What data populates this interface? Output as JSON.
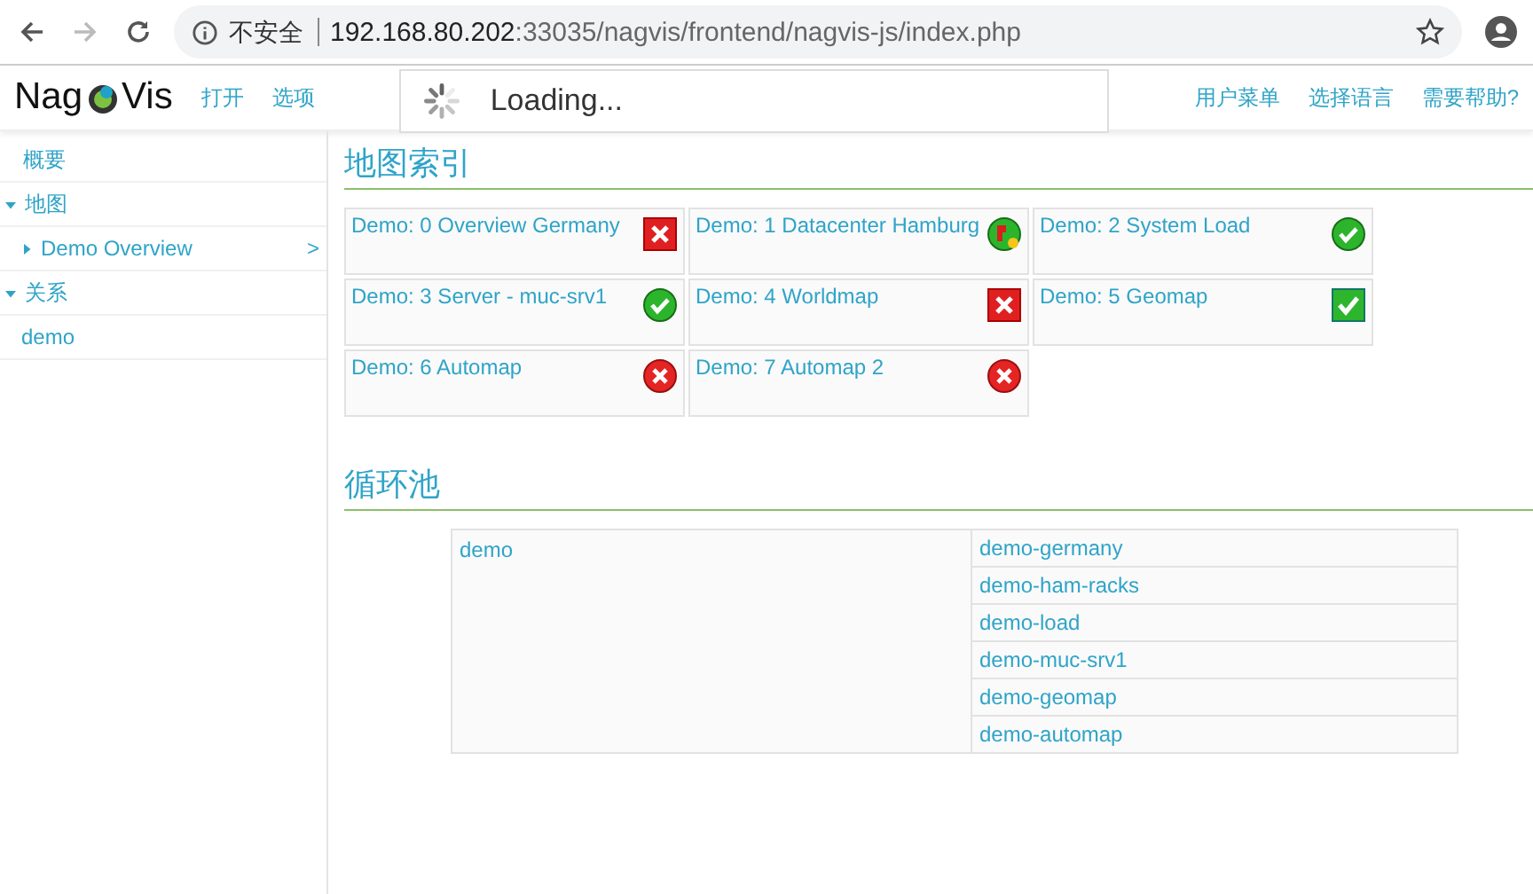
{
  "browser": {
    "security": "不安全",
    "url_host": "192.168.80.202",
    "url_rest": ":33035/nagvis/frontend/nagvis-js/index.php"
  },
  "header": {
    "logo_left": "Nag",
    "logo_right": "Vis",
    "menu": [
      "打开",
      "选项"
    ],
    "right_menu": [
      "用户菜单",
      "选择语言",
      "需要帮助?"
    ]
  },
  "loading": {
    "text": "Loading..."
  },
  "sidebar": {
    "items": [
      {
        "label": "概要",
        "kind": "link"
      },
      {
        "label": "地图",
        "kind": "group",
        "expanded": true,
        "children": [
          {
            "label": "Demo Overview",
            "expanded": false,
            "arrow": ">"
          }
        ]
      },
      {
        "label": "关系",
        "kind": "group",
        "expanded": true,
        "children": [
          {
            "label": "demo"
          }
        ]
      }
    ]
  },
  "map_index": {
    "title": "地图索引",
    "maps": [
      {
        "label": "Demo: 0 Overview Germany",
        "kind": "boxcross"
      },
      {
        "label": "Demo: 1 Datacenter Hamburg",
        "kind": "mixed"
      },
      {
        "label": "Demo: 2 System Load",
        "kind": "circlecheck"
      },
      {
        "label": "Demo: 3 Server - muc-srv1",
        "kind": "circlecheck"
      },
      {
        "label": "Demo: 4 Worldmap",
        "kind": "boxcross"
      },
      {
        "label": "Demo: 5 Geomap",
        "kind": "boxcheck"
      },
      {
        "label": "Demo: 6 Automap",
        "kind": "circlecross"
      },
      {
        "label": "Demo: 7 Automap 2",
        "kind": "circlecross"
      }
    ]
  },
  "rotation_pools": {
    "title": "循环池",
    "pools": [
      {
        "name": "demo",
        "maps": [
          "demo-germany",
          "demo-ham-racks",
          "demo-load",
          "demo-muc-srv1",
          "demo-geomap",
          "demo-automap"
        ]
      }
    ]
  }
}
